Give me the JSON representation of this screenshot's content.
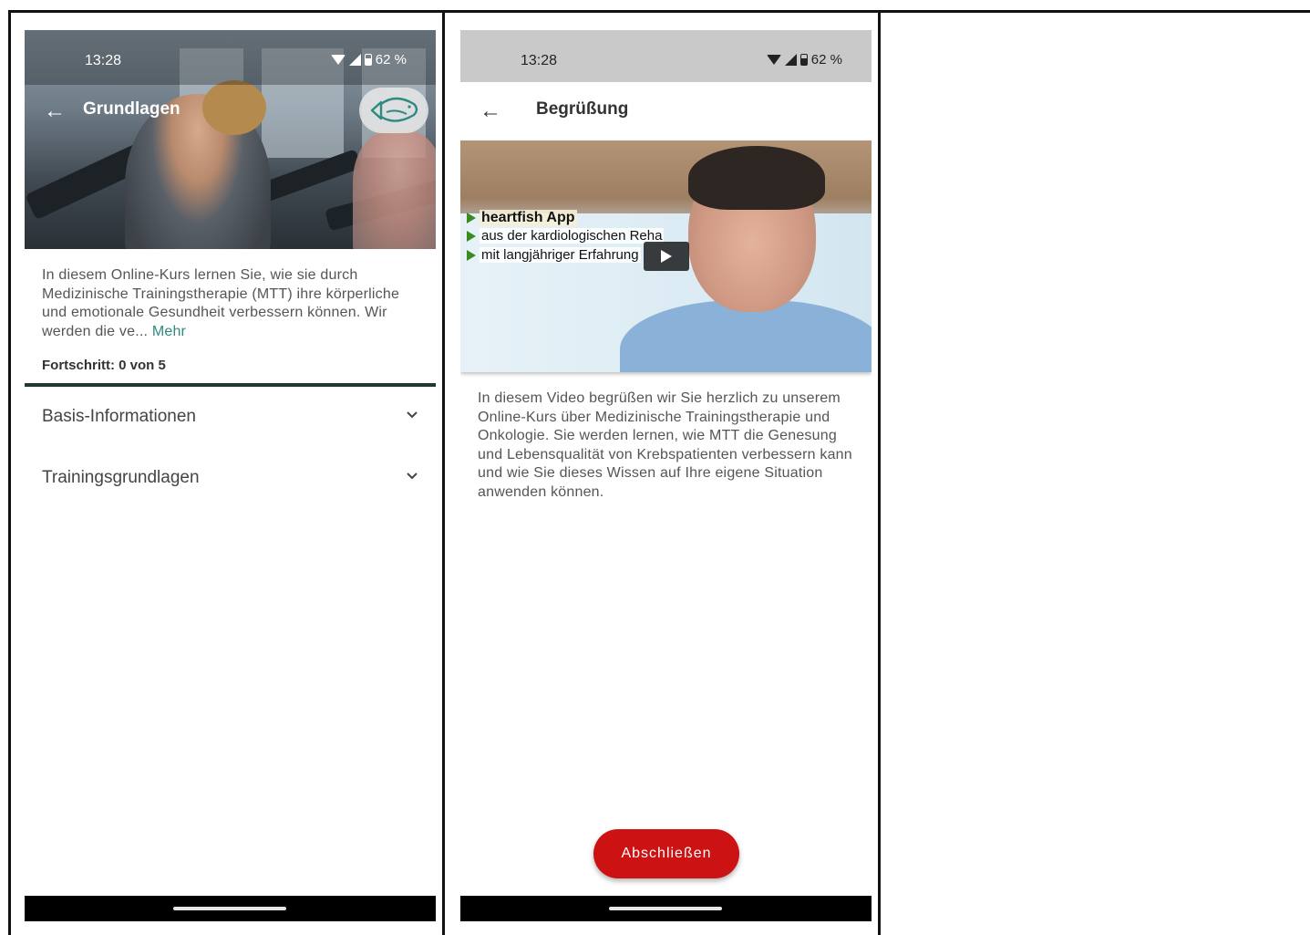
{
  "screen1": {
    "status": {
      "time": "13:28",
      "battery": "62 %"
    },
    "appbar": {
      "back_icon": "←",
      "title": "Grundlagen"
    },
    "description": {
      "text": "In diesem Online-Kurs lernen Sie, wie sie durch Medizinische Trainingstherapie (MTT) ihre körperliche und emotionale Gesundheit verbessern können. Wir werden die ve...",
      "more_link": "Mehr"
    },
    "progress": {
      "label": "Fortschritt: 0 von 5",
      "completed": 0,
      "total": 5
    },
    "sections": [
      {
        "label": "Basis-Informationen"
      },
      {
        "label": "Trainingsgrundlagen"
      }
    ]
  },
  "screen2": {
    "status": {
      "time": "13:28",
      "battery": "62 %"
    },
    "appbar": {
      "back_icon": "←",
      "title": "Begrüßung"
    },
    "video": {
      "lines": [
        "heartfish App",
        "aus der kardiologischen Reha",
        "mit langjähriger Erfahrung"
      ]
    },
    "description": "In diesem Video begrüßen wir Sie herzlich zu unserem Online-Kurs über Medizinische Trainingstherapie und Onkologie. Sie werden lernen, wie MTT die Genesung und Lebensqualität von Krebspatienten verbessern kann und wie Sie dieses Wissen auf Ihre eigene Situation anwenden können.",
    "complete_button": "Abschließen"
  },
  "colors": {
    "accent_teal": "#2e8a80",
    "button_red": "#cc1212",
    "progress_bar": "#1f3a33"
  },
  "icons": [
    "back-arrow-icon",
    "wifi-icon",
    "signal-icon",
    "battery-icon",
    "fish-logo-icon",
    "chevron-down-icon",
    "play-icon"
  ]
}
